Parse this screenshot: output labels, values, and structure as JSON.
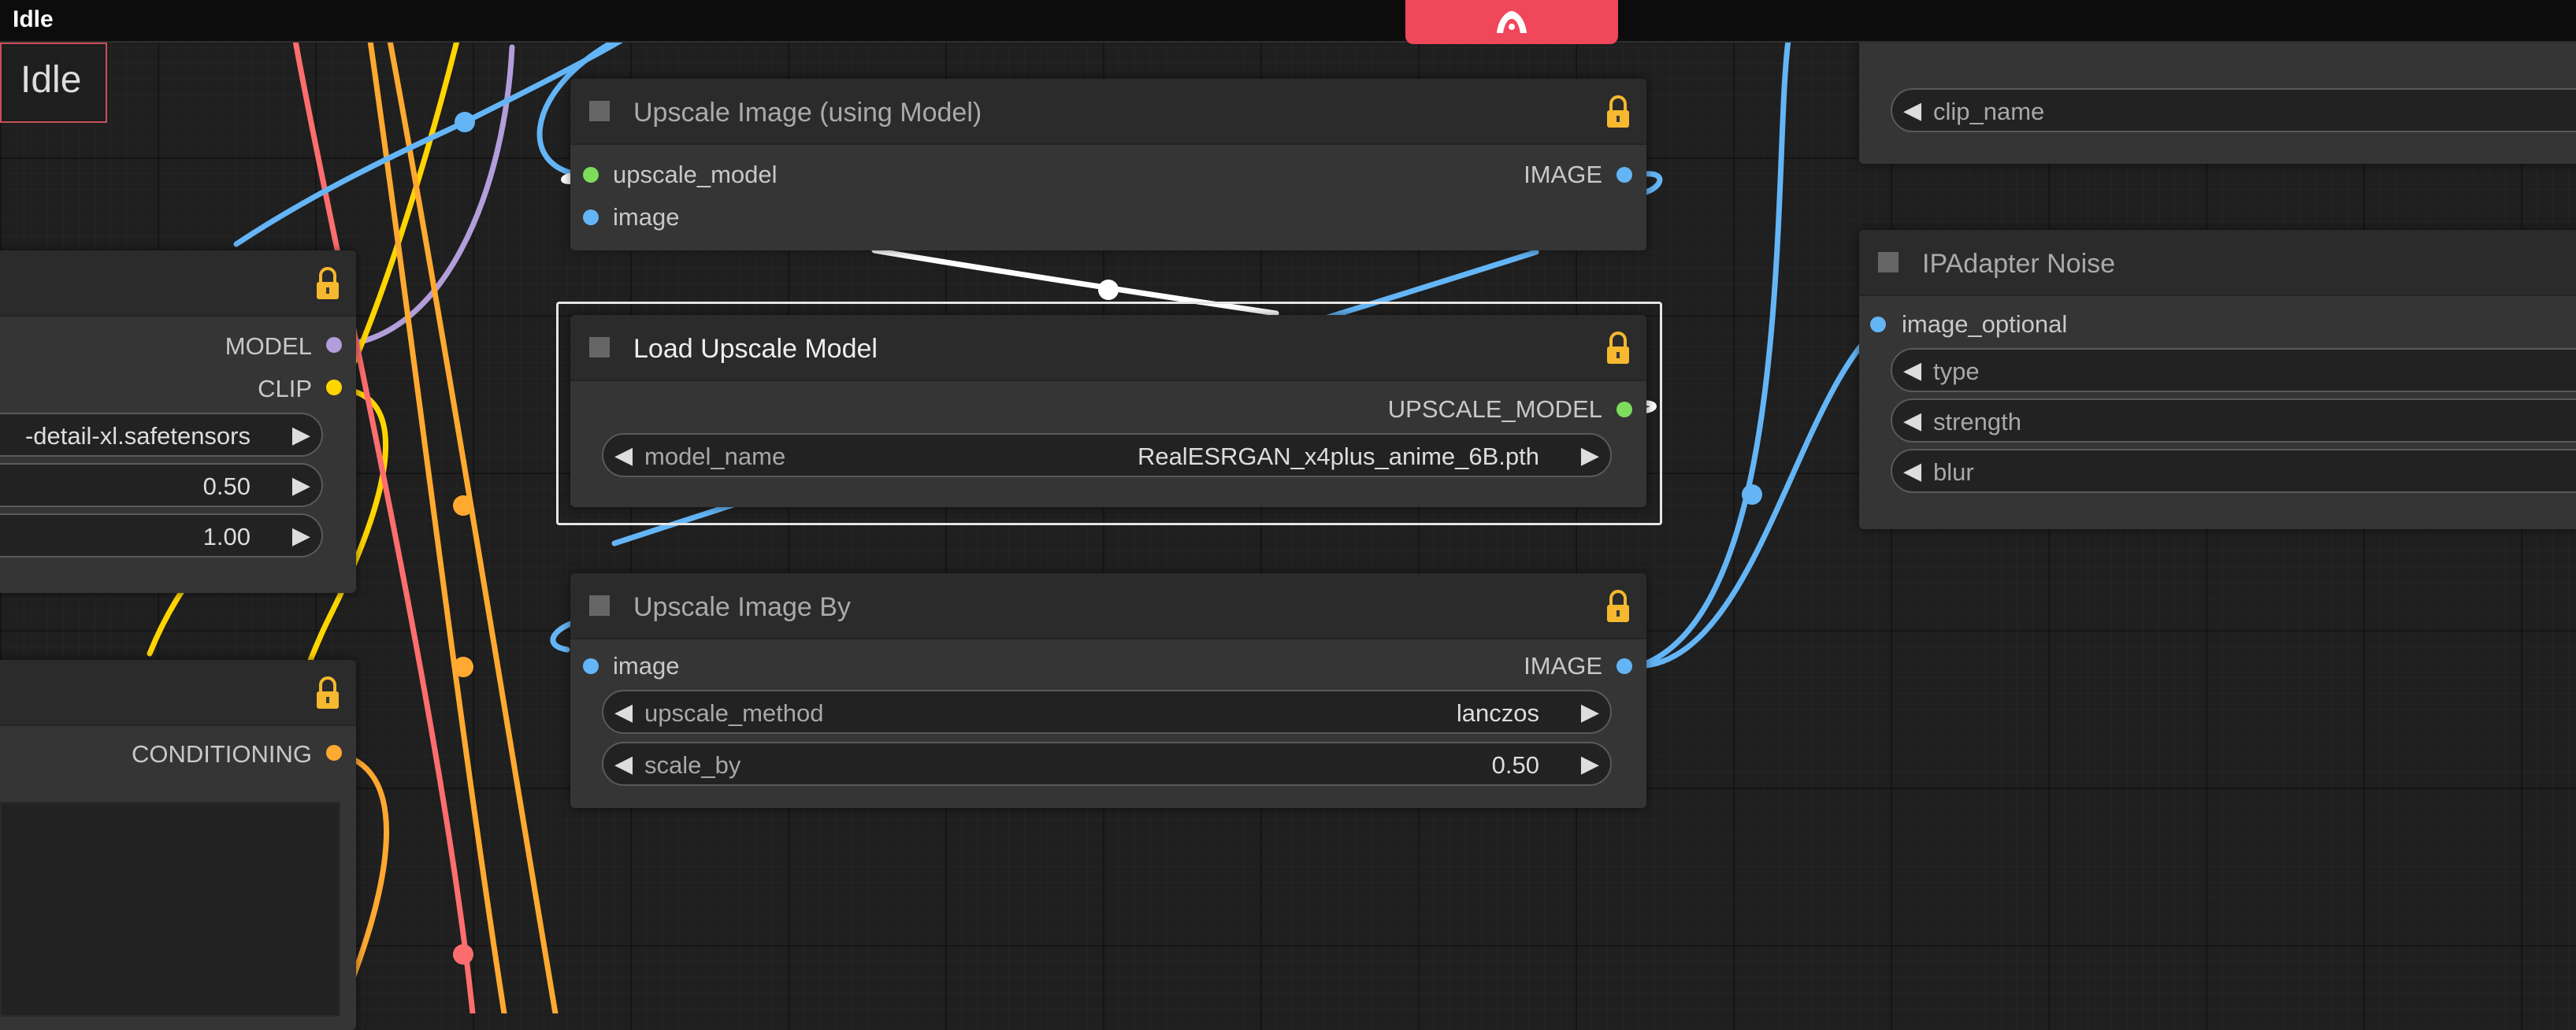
{
  "window": {
    "title": "Idle"
  },
  "status": {
    "label": "Idle"
  },
  "colors": {
    "model": "#b39ddb",
    "clip": "#ffd500",
    "image": "#64b5f6",
    "upscale_model": "#7ddc5c",
    "conditioning": "#ffa931",
    "red_link": "#ff6e6e",
    "white_link": "#ffffff",
    "lock": "#f5b82e",
    "menu_button": "#f0475a"
  },
  "icons": {
    "menu": "comfy-logo-icon",
    "lock": "lock-icon",
    "collapse": "collapse-square-icon"
  },
  "nodes": {
    "lora": {
      "outputs": [
        "MODEL",
        "CLIP"
      ],
      "widgets": [
        {
          "value": "-detail-xl.safetensors"
        },
        {
          "value": "0.50"
        },
        {
          "value": "1.00"
        }
      ]
    },
    "text_encode": {
      "outputs": [
        "CONDITIONING"
      ]
    },
    "upscale_with_model": {
      "title": "Upscale Image (using Model)",
      "inputs": [
        "upscale_model",
        "image"
      ],
      "outputs": [
        "IMAGE"
      ]
    },
    "load_upscale_model": {
      "title": "Load Upscale Model",
      "outputs": [
        "UPSCALE_MODEL"
      ],
      "widgets": [
        {
          "label": "model_name",
          "value": "RealESRGAN_x4plus_anime_6B.pth"
        }
      ]
    },
    "upscale_by": {
      "title": "Upscale Image By",
      "inputs": [
        "image"
      ],
      "outputs": [
        "IMAGE"
      ],
      "widgets": [
        {
          "label": "upscale_method",
          "value": "lanczos"
        },
        {
          "label": "scale_by",
          "value": "0.50"
        }
      ]
    },
    "clip_vision": {
      "widgets": [
        {
          "label": "clip_name"
        }
      ]
    },
    "ipadapter_noise": {
      "title": "IPAdapter Noise",
      "inputs": [
        "image_optional"
      ],
      "widgets": [
        {
          "label": "type"
        },
        {
          "label": "strength"
        },
        {
          "label": "blur"
        }
      ]
    }
  }
}
